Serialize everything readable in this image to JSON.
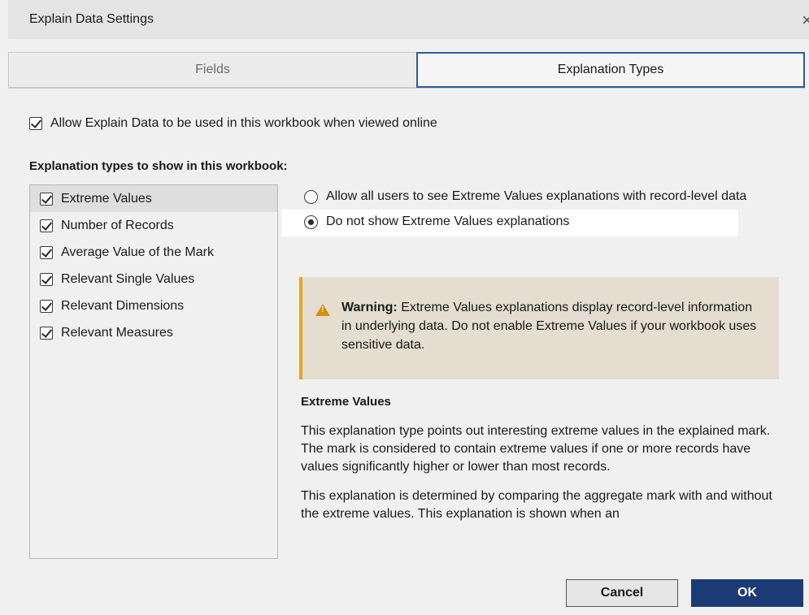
{
  "dialog": {
    "title": "Explain Data Settings",
    "close_glyph": "×"
  },
  "tabs": [
    {
      "label": "Fields",
      "active": false
    },
    {
      "label": "Explanation Types",
      "active": true
    }
  ],
  "allow": {
    "checked": true,
    "label": "Allow Explain Data to be used in this workbook when viewed online"
  },
  "types_section": {
    "label": "Explanation types to show in this workbook:",
    "items": [
      {
        "label": "Extreme Values",
        "checked": true,
        "selected": true
      },
      {
        "label": "Number of Records",
        "checked": true
      },
      {
        "label": "Average Value of the Mark",
        "checked": true
      },
      {
        "label": "Relevant Single Values",
        "checked": true
      },
      {
        "label": "Relevant Dimensions",
        "checked": true
      },
      {
        "label": "Relevant Measures",
        "checked": true
      }
    ]
  },
  "options": [
    {
      "label": "Allow all users to see Extreme Values explanations with record-level data",
      "selected": false
    },
    {
      "label": "Do not show Extreme Values explanations",
      "selected": true
    }
  ],
  "warning": {
    "label": "Warning:",
    "text": "Extreme Values explanations display record-level information in underlying data. Do not enable Extreme Values if your workbook uses sensitive data.",
    "accent_color": "#e7a524",
    "background_color": "#e4ddd0"
  },
  "description": {
    "title": "Extreme Values",
    "paragraphs": [
      "This explanation type points out interesting extreme values in the explained mark. The mark is considered to contain extreme values if one or more records have values significantly higher or lower than most records.",
      "This explanation is determined by comparing the aggregate mark with and without the extreme values. This explanation is shown when an"
    ]
  },
  "buttons": {
    "cancel": "Cancel",
    "ok": "OK",
    "ok_color": "#1b3a76",
    "active_tab_border_color": "#2a5d9b"
  }
}
